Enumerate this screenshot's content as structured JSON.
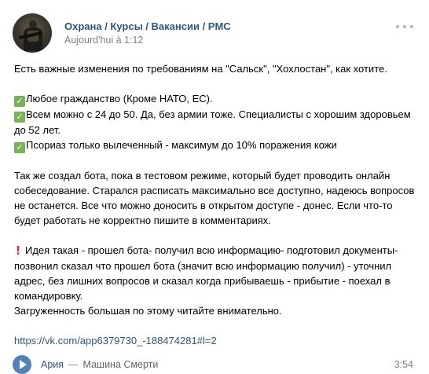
{
  "post": {
    "author": "Охрана / Курсы / Вакансии / PMC",
    "time": "Aujourd'hui à 1:12",
    "more_icon": "more-horizontal-icon",
    "lines": {
      "intro": "Есть важные изменения по требованиям на \"Сальск\", \"Хохлостан\", как хотите.",
      "req1": "Любое гражданство (Кроме НАТО, ЕС).",
      "req2": "Всем можно с 24 до 50. Да, без армии тоже. Специалисты с хорошим здоровьем до 52 лет.",
      "req3": "Псориаз только вылеченный - максимум до 10% поражения кожи",
      "bot": "Так же создал бота, пока в тестовом режиме, который будет проводить онлайн собеседование. Старался расписать максимально все доступно, надеюсь вопросов не останется. Все что можно доносить в открытом доступе - донес. Если что-то будет работать не корректно пишите в комментариях.",
      "idea": "Идея такая - прошел бота- получил всю информацию- подготовил документы- позвонил сказал что прошел бота (значит всю информацию получил) - уточнил адрес, без лишних вопросов и сказал когда прибываешь - прибытие - поехал в командировку.",
      "load": "Загруженность большая по этому читайте внимательно.",
      "link": "https://vk.com/app6379730_-188474281#l=2"
    },
    "icons": {
      "check": "✓",
      "exclamation": "!"
    },
    "audio": {
      "artist": "Ария",
      "separator": "—",
      "title": "Машина Смерти",
      "duration": "3:54"
    }
  },
  "colors": {
    "link": "#2a5885",
    "meta": "#828282",
    "check_green": "#77b255",
    "exclamation_red": "#dd2e44",
    "play_blue": "#5181b8"
  }
}
